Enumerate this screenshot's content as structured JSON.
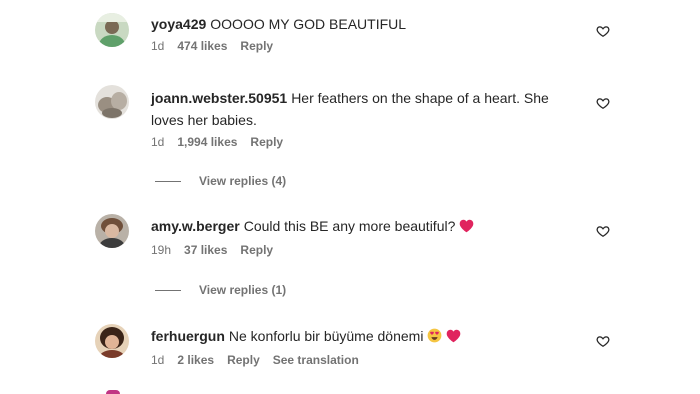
{
  "comments": [
    {
      "username": "yoya429",
      "text": "OOOOO MY GOD BEAUTIFUL",
      "time": "1d",
      "likes": "474 likes",
      "reply": "Reply"
    },
    {
      "username": "joann.webster.50951",
      "text_line1": "Her feathers on the shape of a heart. She",
      "text_line2": "loves her babies.",
      "time": "1d",
      "likes": "1,994 likes",
      "reply": "Reply",
      "view_replies": "View replies (4)"
    },
    {
      "username": "amy.w.berger",
      "text": "Could this BE any more beautiful?",
      "emoji": "red-heart",
      "time": "19h",
      "likes": "37 likes",
      "reply": "Reply",
      "view_replies": "View replies (1)"
    },
    {
      "username": "ferhuergun",
      "text": "Ne konforlu bir büyüme dönemi",
      "emoji": [
        "heart-eyes",
        "red-heart"
      ],
      "time": "1d",
      "likes": "2 likes",
      "reply": "Reply",
      "translation": "See translation"
    }
  ],
  "icons": {
    "like": "heart-outline-icon",
    "emoji_heart": "red-heart-emoji",
    "emoji_heart_eyes": "heart-eyes-emoji"
  },
  "colors": {
    "text": "#262626",
    "secondary": "#737373",
    "heart": "#e0245e"
  }
}
